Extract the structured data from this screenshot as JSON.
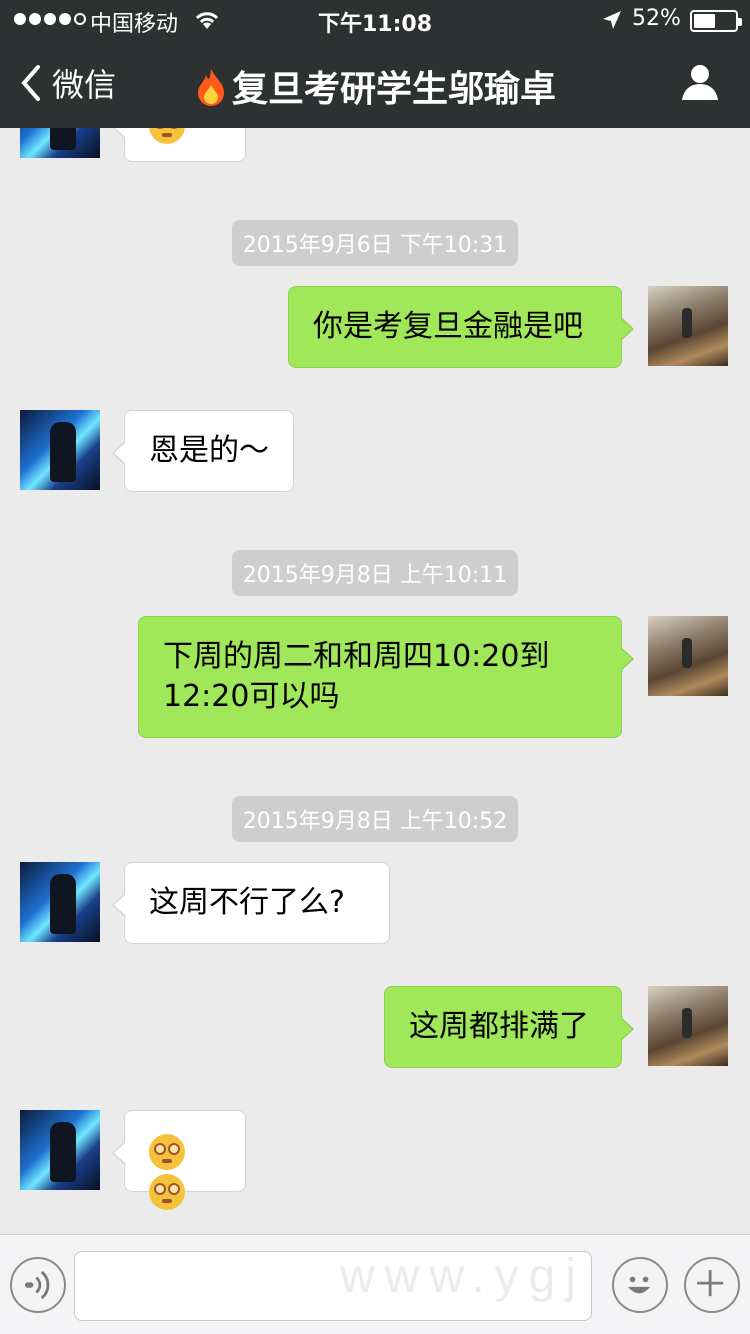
{
  "status_bar": {
    "carrier": "中国移动",
    "time": "下午11:08",
    "battery_percent": "52%",
    "battery_level": 0.52
  },
  "nav": {
    "back_label": "微信",
    "title": "复旦考研学生邬瑜卓",
    "back_icon": "chevron-left-icon",
    "profile_icon": "person-icon",
    "title_icon": "fire-icon"
  },
  "messages": [
    {
      "type": "time",
      "text": "2015年9月6日 下午10:31"
    },
    {
      "type": "msg",
      "from": "me",
      "text": "你是考复旦金融是吧"
    },
    {
      "type": "msg",
      "from": "them",
      "text": "恩是的～"
    },
    {
      "type": "time",
      "text": "2015年9月8日 上午10:11"
    },
    {
      "type": "msg",
      "from": "me",
      "text": "下周的周二和和周四10:20到12:20可以吗"
    },
    {
      "type": "time",
      "text": "2015年9月8日 上午10:52"
    },
    {
      "type": "msg",
      "from": "them",
      "text": "这周不行了么?"
    },
    {
      "type": "msg",
      "from": "me",
      "text": "这周都排满了"
    },
    {
      "type": "msg",
      "from": "them",
      "emoji": "dizzy-face-emoji"
    }
  ],
  "watermark": "www.ygj",
  "colors": {
    "nav_bg": "#2e3132",
    "chat_bg": "#ebebeb",
    "my_bubble": "#a0e75a",
    "their_bubble": "#ffffff",
    "time_pill": "#cecece"
  }
}
